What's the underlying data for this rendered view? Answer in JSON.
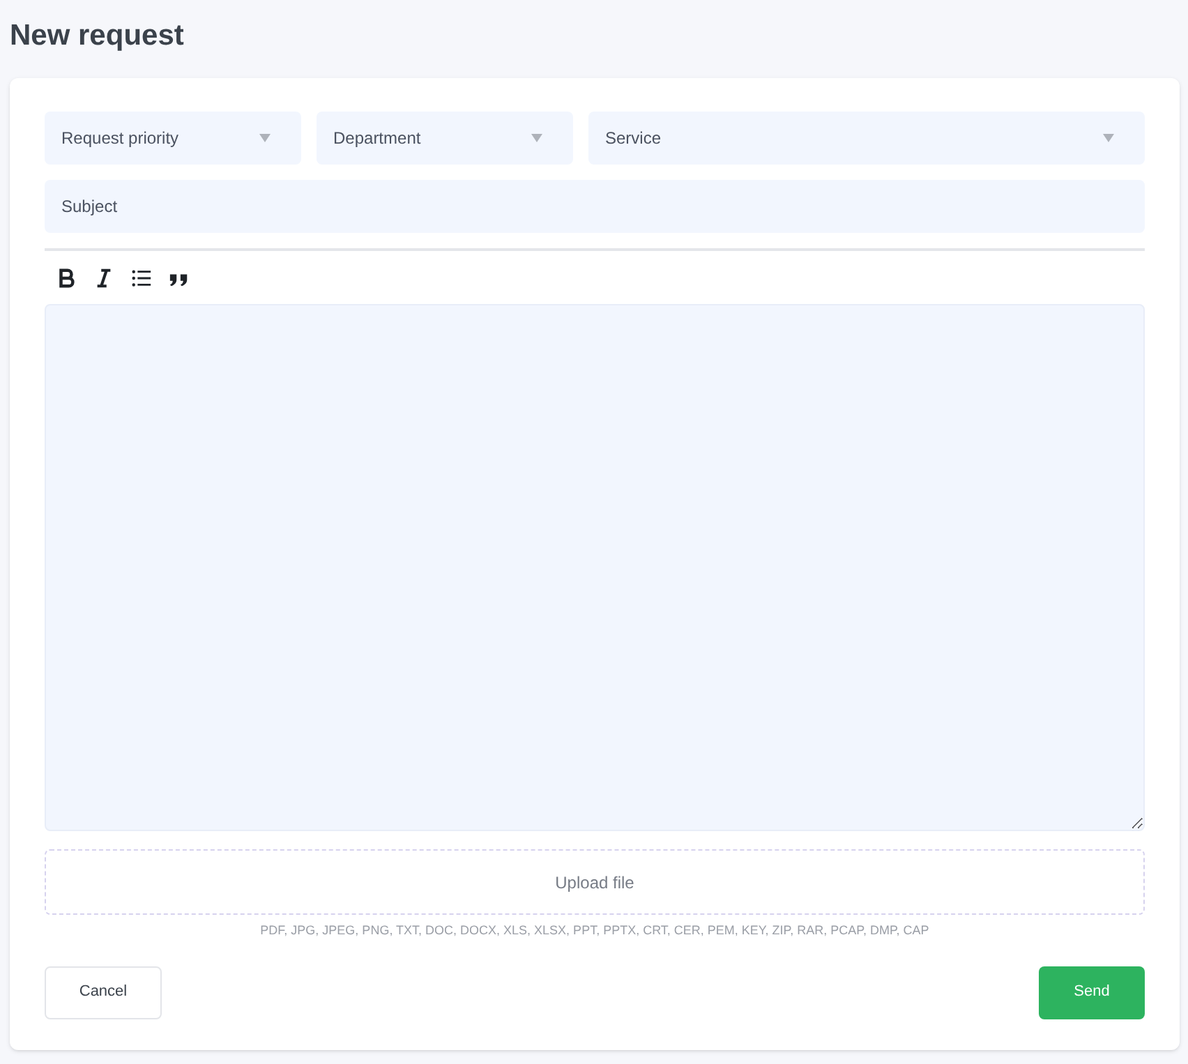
{
  "title": "New request",
  "selects": [
    {
      "placeholder": "Request priority"
    },
    {
      "placeholder": "Department"
    },
    {
      "placeholder": "Service"
    }
  ],
  "subject": {
    "placeholder": "Subject"
  },
  "toolbar": [
    {
      "kind": "bold"
    },
    {
      "kind": "italic"
    },
    {
      "kind": "list"
    },
    {
      "kind": "quote"
    }
  ],
  "upload": {
    "label": "Upload file",
    "formats": "PDF, JPG, JPEG, PNG, TXT, DOC, DOCX, XLS, XLSX, PPT, PPTX, CRT, CER, PEM, KEY, ZIP, RAR, PCAP, DMP, CAP"
  },
  "buttons": [
    {
      "label": "Cancel",
      "kind": "secondary"
    },
    {
      "label": "Send",
      "kind": "primary"
    }
  ]
}
